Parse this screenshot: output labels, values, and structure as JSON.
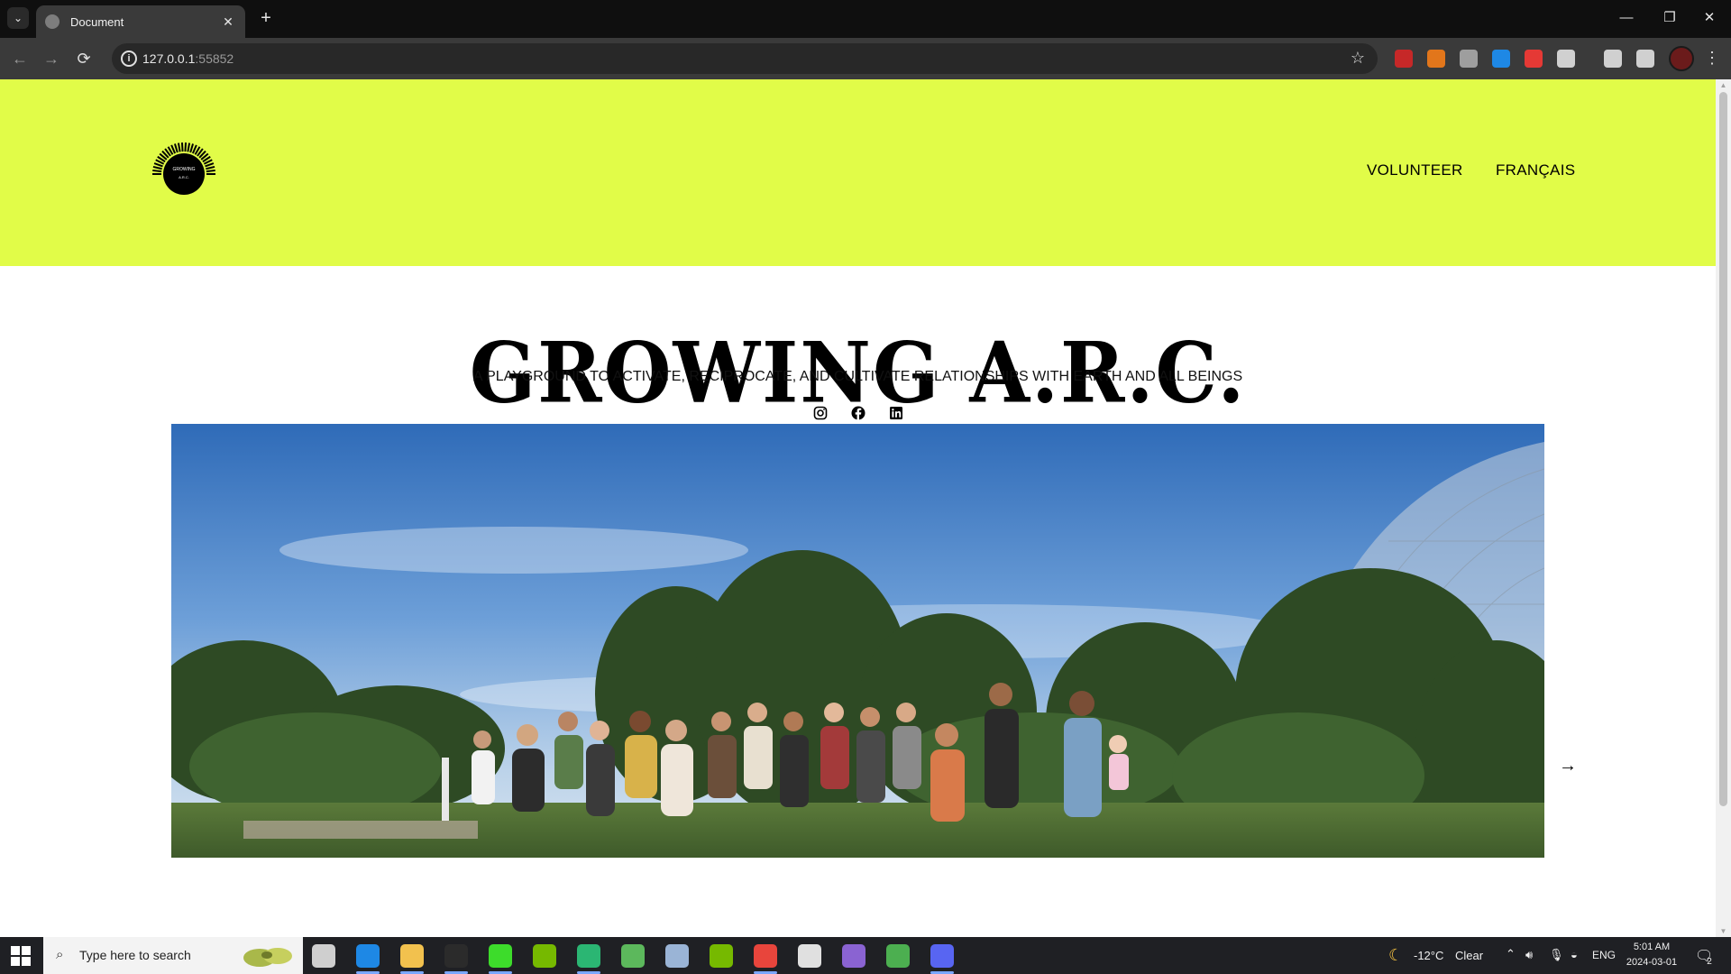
{
  "browser": {
    "tab_title": "Document",
    "new_tab_symbol": "+",
    "tab_close_symbol": "✕",
    "url_host": "127.0.0.1",
    "url_port": ":55852",
    "window_controls": {
      "minimize": "—",
      "restore": "❐",
      "close": "✕"
    },
    "nav": {
      "back": "←",
      "forward": "→",
      "reload": "⟳"
    },
    "bookmark_star": "☆",
    "menu_dots": "⋮",
    "extensions": [
      {
        "name": "ublock-icon",
        "color": "#c62828"
      },
      {
        "name": "metamask-icon",
        "color": "#e2761b"
      },
      {
        "name": "extension-shield-icon",
        "color": "#9e9e9e"
      },
      {
        "name": "translate-extension-icon",
        "color": "#1e88e5"
      },
      {
        "name": "red-circle-extension-icon",
        "color": "#e53935"
      },
      {
        "name": "puzzle-extensions-icon",
        "color": "#d0d0d0"
      },
      {
        "name": "media-control-icon",
        "color": "#d0d0d0"
      },
      {
        "name": "side-panel-icon",
        "color": "#d0d0d0"
      }
    ]
  },
  "site": {
    "header_color": "#e1fc48",
    "logo_alt": "GROWING A.R.C.",
    "nav": {
      "volunteer": "VOLUNTEER",
      "french": "FRANÇAIS"
    },
    "hero": {
      "title": "GROWING A.R.C.",
      "subtitle": "A PLAYGROUND TO ACTIVATE, RECIPROCATE, AND CULTIVATE RELATIONSHIPS WITH EARTH AND ALL BEINGS"
    },
    "socials": [
      "instagram-icon",
      "facebook-icon",
      "linkedin-icon"
    ],
    "carousel": {
      "next_symbol": "→"
    }
  },
  "taskbar": {
    "search_placeholder": "Type here to search",
    "apps": [
      {
        "name": "task-view-icon",
        "color": "#cfcfcf"
      },
      {
        "name": "mail-icon",
        "color": "#1e88e5"
      },
      {
        "name": "file-explorer-icon",
        "color": "#f2c14e"
      },
      {
        "name": "linear-app-icon",
        "color": "#2b2b2b"
      },
      {
        "name": "green-app-icon",
        "color": "#3ddc2b"
      },
      {
        "name": "nvidia-icon",
        "color": "#76b900"
      },
      {
        "name": "teal-app-icon",
        "color": "#2bb673"
      },
      {
        "name": "cube-app-icon",
        "color": "#5cb85c"
      },
      {
        "name": "virtual-machine-icon",
        "color": "#9ab4d6"
      },
      {
        "name": "nvidia-experience-icon",
        "color": "#76b900"
      },
      {
        "name": "chrome-icon",
        "color": "#e8453c"
      },
      {
        "name": "settings-icon",
        "color": "#e0e0e0"
      },
      {
        "name": "github-icon",
        "color": "#8a63d2"
      },
      {
        "name": "minecraft-icon",
        "color": "#4caf50"
      },
      {
        "name": "discord-icon",
        "color": "#5865f2"
      }
    ],
    "weather": {
      "temp": "-12°C",
      "condition": "Clear"
    },
    "language": "ENG",
    "time": "5:01 AM",
    "date": "2024-03-01",
    "notifications_count": "2"
  }
}
